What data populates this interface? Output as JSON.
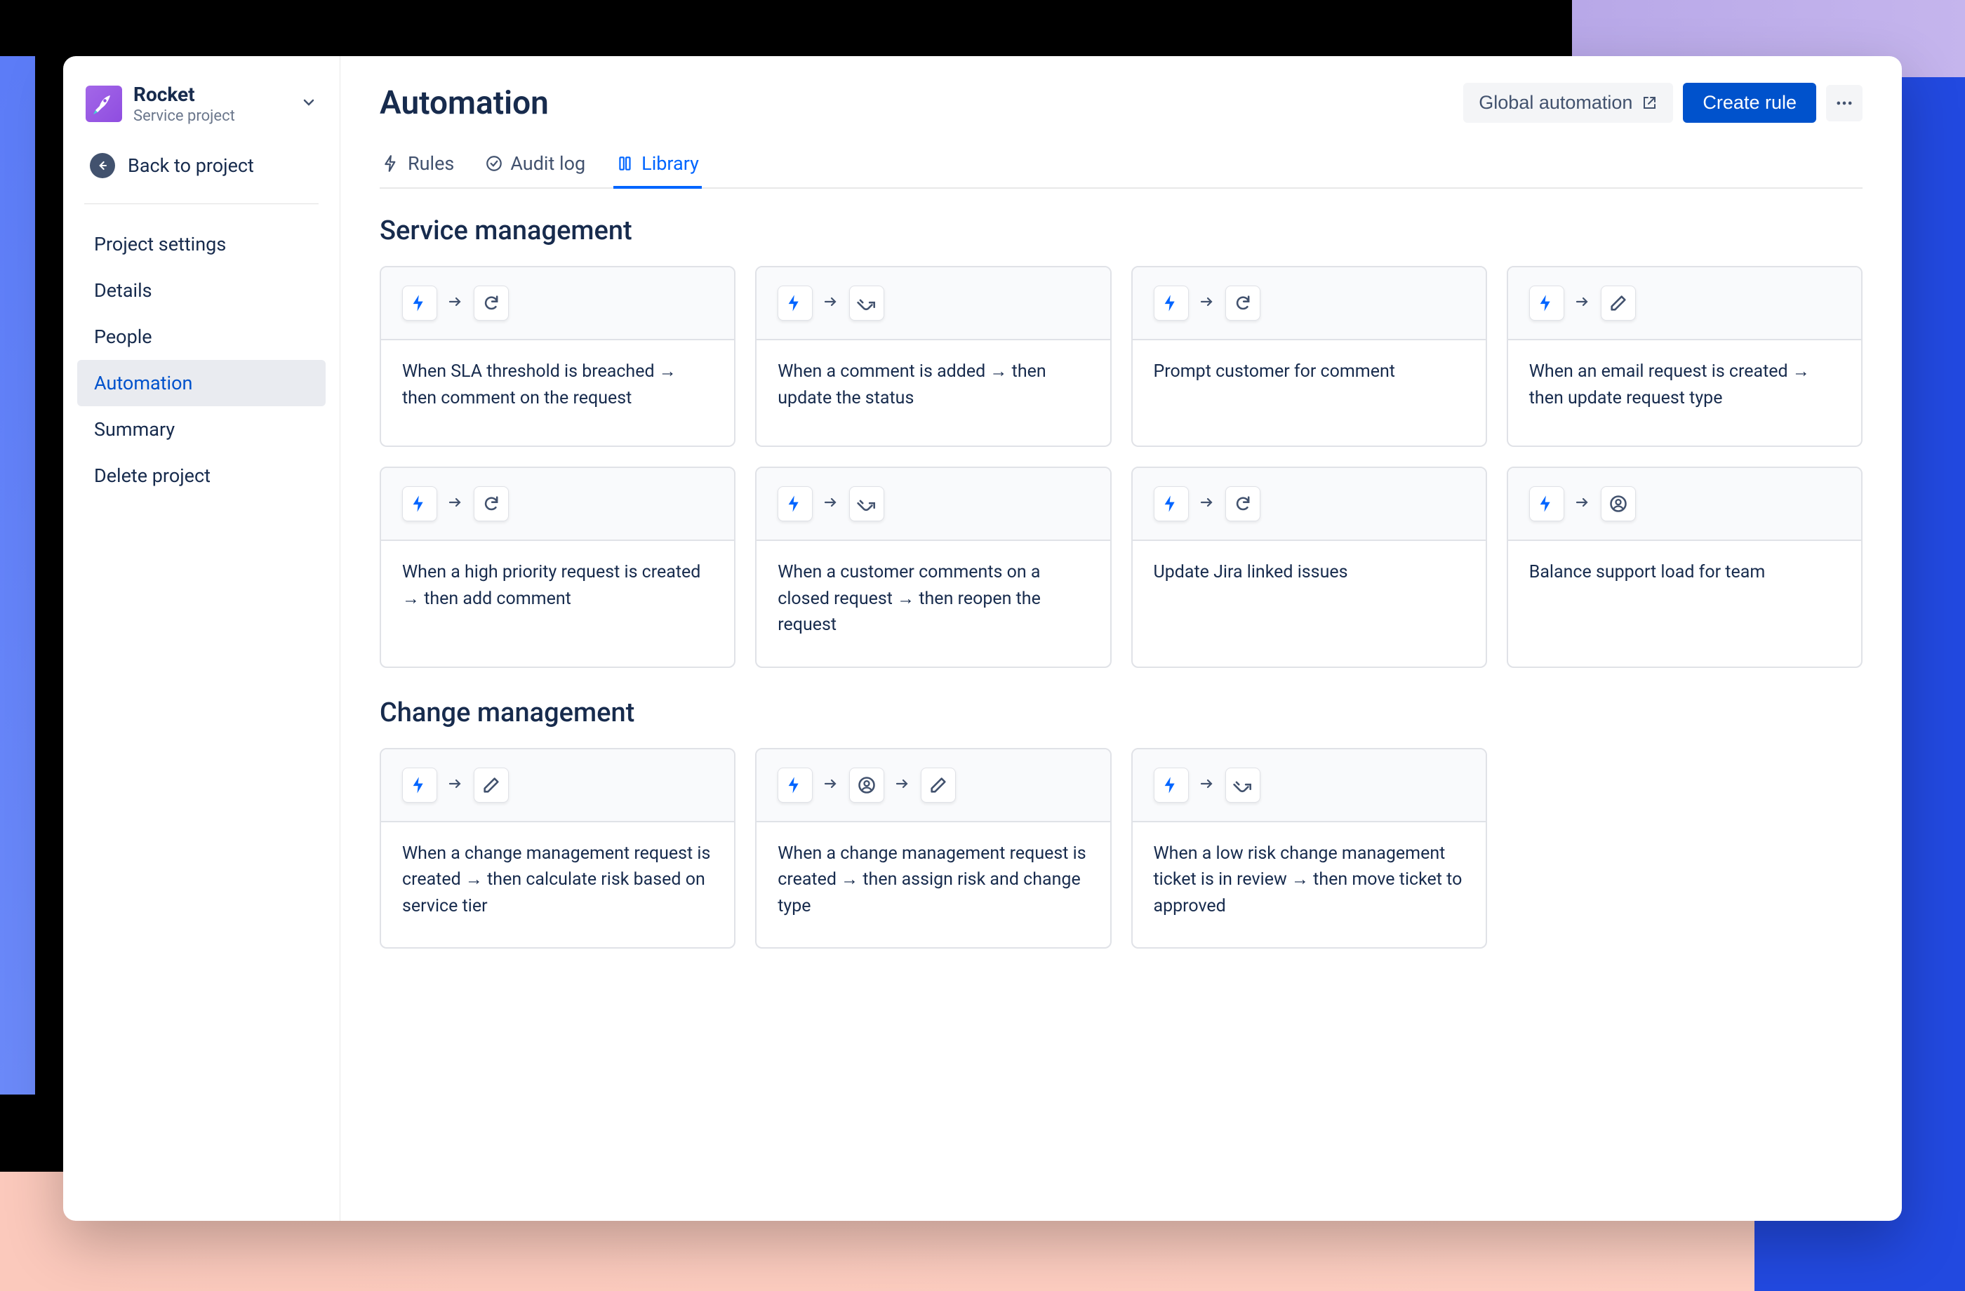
{
  "project": {
    "name": "Rocket",
    "type": "Service project"
  },
  "sidebar": {
    "back_label": "Back to project",
    "items": [
      "Project settings",
      "Details",
      "People",
      "Automation",
      "Summary",
      "Delete project"
    ],
    "active_index": 3
  },
  "header": {
    "title": "Automation",
    "global_label": "Global automation",
    "create_label": "Create rule"
  },
  "tabs": [
    {
      "label": "Rules",
      "icon": "lightning"
    },
    {
      "label": "Audit log",
      "icon": "checkcircle"
    },
    {
      "label": "Library",
      "icon": "library"
    }
  ],
  "active_tab": 2,
  "sections": [
    {
      "title": "Service management",
      "cards": [
        {
          "icons": [
            "trigger",
            "refresh"
          ],
          "desc": "When SLA threshold is breached → then comment on the request"
        },
        {
          "icons": [
            "trigger",
            "branch"
          ],
          "desc": "When a comment is added → then update the status"
        },
        {
          "icons": [
            "trigger",
            "refresh"
          ],
          "desc": "Prompt customer for comment"
        },
        {
          "icons": [
            "trigger",
            "edit"
          ],
          "desc": "When an email request is created → then update request type"
        },
        {
          "icons": [
            "trigger",
            "refresh"
          ],
          "desc": "When a high priority request is created → then add comment"
        },
        {
          "icons": [
            "trigger",
            "branch"
          ],
          "desc": "When a customer comments on a closed request → then reopen the request"
        },
        {
          "icons": [
            "trigger",
            "refresh"
          ],
          "desc": "Update Jira linked issues"
        },
        {
          "icons": [
            "trigger",
            "user"
          ],
          "desc": "Balance support load for team"
        }
      ]
    },
    {
      "title": "Change management",
      "cards": [
        {
          "icons": [
            "trigger",
            "edit"
          ],
          "desc": "When a change management request is created → then calculate risk based on service tier"
        },
        {
          "icons": [
            "trigger",
            "user",
            "edit"
          ],
          "desc": "When a change management request is created → then assign risk and change type"
        },
        {
          "icons": [
            "trigger",
            "branch"
          ],
          "desc": "When a low risk change management ticket is in review → then move ticket to approved"
        }
      ]
    }
  ]
}
